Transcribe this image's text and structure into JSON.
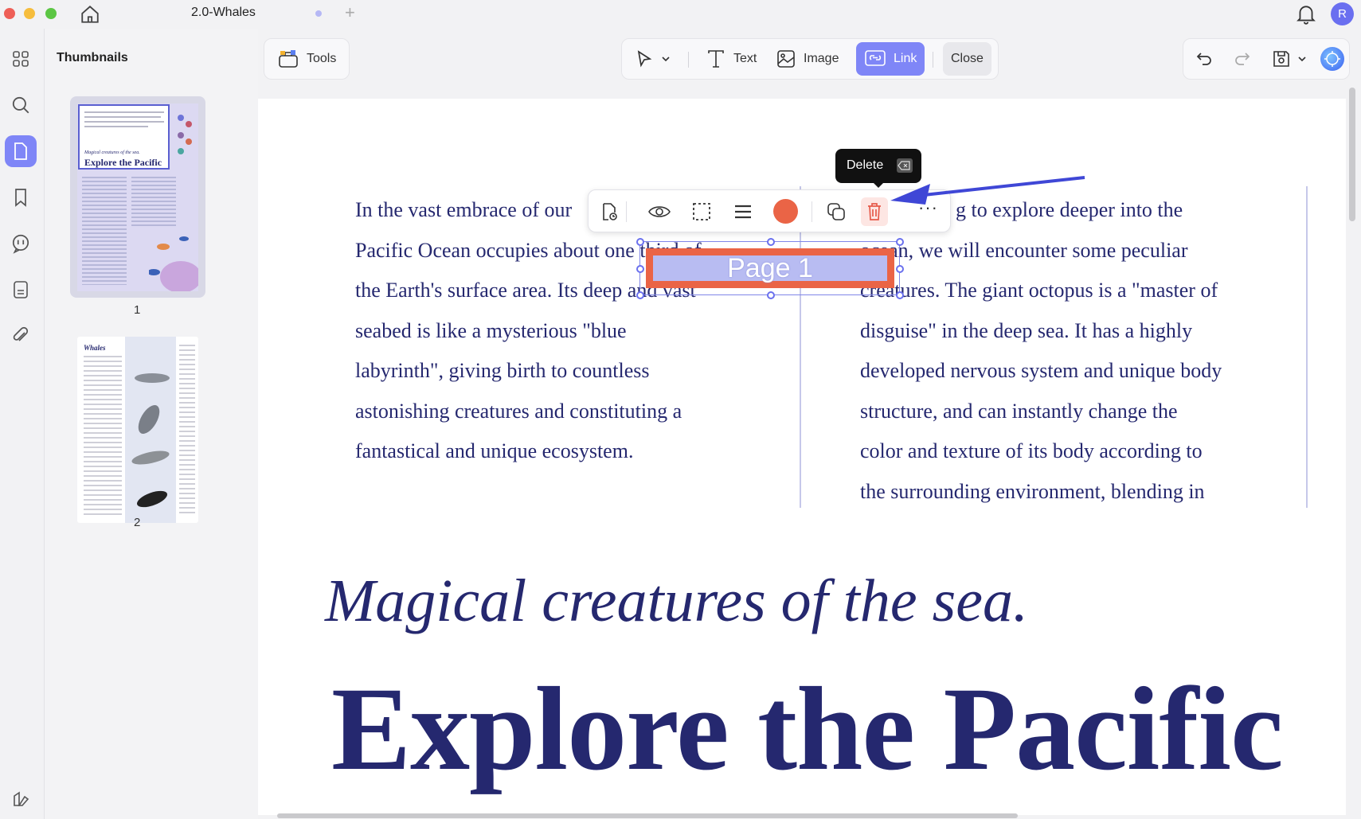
{
  "window": {
    "tab_title": "2.0-Whales",
    "avatar_letter": "R"
  },
  "sidebar": {
    "title": "Thumbnails",
    "pages": [
      {
        "label": "1"
      },
      {
        "label": "2"
      }
    ]
  },
  "thumbnail1": {
    "subtitle": "Magical creatures of the sea.",
    "title": "Explore the Pacific"
  },
  "thumbnail2": {
    "title": "Whales"
  },
  "toolbar": {
    "tools_label": "Tools",
    "text_label": "Text",
    "image_label": "Image",
    "link_label": "Link",
    "close_label": "Close"
  },
  "link_popup": {
    "tooltip_label": "Delete",
    "color": "#ea6446",
    "link_text": "Page 1"
  },
  "document": {
    "column1_lines": [
      "In the vast embrace of our",
      "Pacific Ocean occupies about one third of",
      "the Earth's surface area. Its deep and vast",
      "seabed is like a mysterious \"blue",
      "labyrinth\", giving birth to countless",
      "astonishing creatures and constituting a",
      "fantastical and unique ecosystem."
    ],
    "column2_lines": [
      "g to explore deeper into the",
      "ocean, we will encounter some peculiar",
      "creatures. The giant octopus is a \"master of",
      "disguise\" in the deep sea. It has a highly",
      "developed nervous system and unique body",
      "structure, and can instantly change the",
      "color and texture of its body according to",
      "the surrounding environment, blending in"
    ],
    "subtitle": "Magical creatures of the sea.",
    "title": "Explore the Pacific"
  },
  "colors": {
    "accent": "#7f86f7",
    "text_navy": "#25286f",
    "link_box": "#ea6446",
    "arrow": "#3f47d6"
  }
}
